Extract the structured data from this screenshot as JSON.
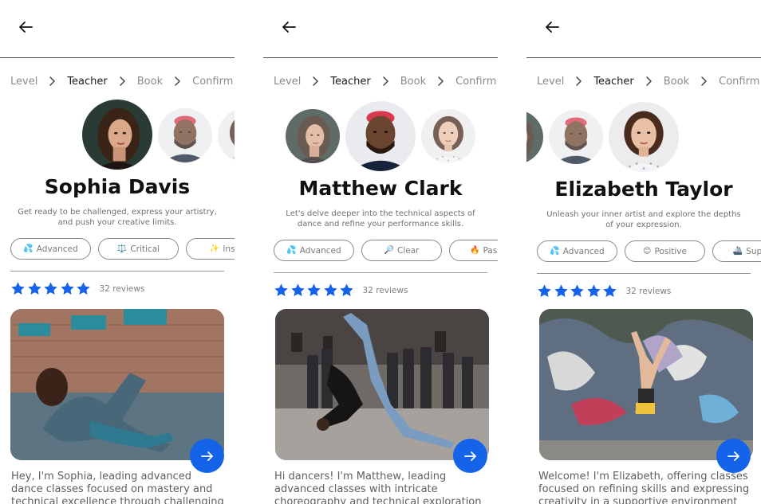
{
  "colors": {
    "accent": "#1463e8",
    "star": "#1463e8"
  },
  "steps": [
    "Level",
    "Teacher",
    "Book",
    "Confirm"
  ],
  "screens": [
    {
      "teacher": {
        "name": "Sophia Davis",
        "description": "Get ready to be challenged, express your artistry, and push your creative limits.",
        "tags": [
          {
            "icon": "💦",
            "label": "Advanced"
          },
          {
            "icon": "⚖️",
            "label": "Critical"
          },
          {
            "icon": "✨",
            "label": "Inspi"
          }
        ],
        "rating": 5,
        "reviews": "32 reviews",
        "bio": "Hey, I'm Sophia, leading advanced dance classes focused on mastery and technical excellence through challenging"
      }
    },
    {
      "teacher": {
        "name": "Matthew Clark",
        "description": "Let's delve deeper into the technical aspects of dance and refine your performance skills.",
        "tags": [
          {
            "icon": "💦",
            "label": "Advanced"
          },
          {
            "icon": "🔎",
            "label": "Clear"
          },
          {
            "icon": "🔥",
            "label": "Passio"
          }
        ],
        "rating": 5,
        "reviews": "32 reviews",
        "bio": "Hi dancers! I'm Matthew, leading advanced classes with intricate choreography and technical exploration to push your artistry"
      }
    },
    {
      "teacher": {
        "name": "Elizabeth Taylor",
        "description": "Unleash your inner artist and explore the depths of your expression.",
        "tags": [
          {
            "icon": "💦",
            "label": "Advanced"
          },
          {
            "icon": "😊",
            "label": "Positive"
          },
          {
            "icon": "🚢",
            "label": "Suppo"
          }
        ],
        "rating": 5,
        "reviews": "32 reviews",
        "bio": "Welcome! I'm Elizabeth, offering classes focused on refining skills and expressing creativity in a supportive environment for"
      }
    }
  ]
}
